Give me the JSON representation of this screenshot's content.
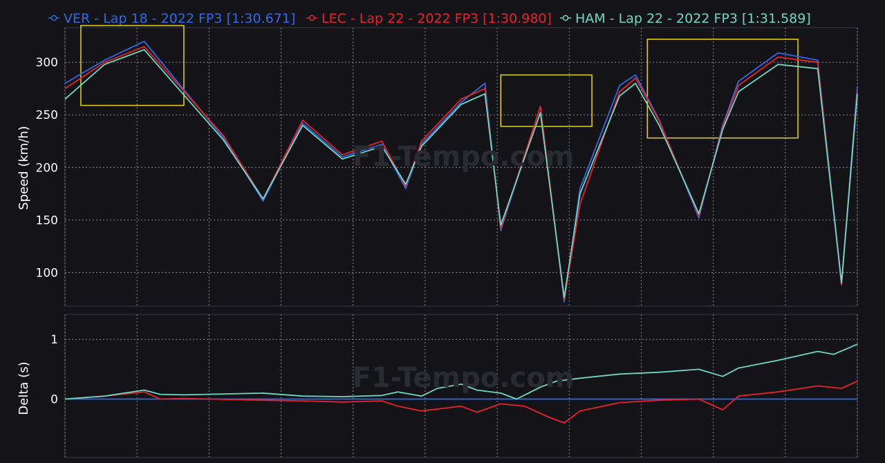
{
  "chart_data": [
    {
      "type": "line",
      "ylabel": "Speed (km/h)",
      "ylim": [
        68,
        333
      ],
      "yticks": [
        100,
        150,
        200,
        250,
        300
      ],
      "grid": true,
      "legend_position": "top",
      "watermark": "F1-Tempo.com",
      "series": [
        {
          "name": "VER - Lap 18 - 2022 FP3 [1:30.671]",
          "color": "#2f6be6",
          "x": [
            0,
            5,
            10,
            20,
            25,
            30,
            35,
            40,
            43,
            45,
            50,
            53,
            55,
            60,
            63,
            65,
            70,
            72,
            75,
            80,
            83,
            85,
            90,
            95,
            98,
            100
          ],
          "values": [
            280,
            302,
            320,
            228,
            168,
            242,
            210,
            222,
            180,
            222,
            262,
            280,
            140,
            258,
            72,
            180,
            278,
            288,
            245,
            152,
            240,
            282,
            309,
            302,
            90,
            277
          ]
        },
        {
          "name": "LEC - Lap 22 - 2022 FP3 [1:30.980]",
          "color": "#e8232b",
          "x": [
            0,
            5,
            10,
            20,
            25,
            30,
            35,
            40,
            43,
            45,
            50,
            53,
            55,
            60,
            63,
            65,
            70,
            72,
            75,
            80,
            83,
            85,
            90,
            95,
            98,
            100
          ],
          "values": [
            275,
            300,
            315,
            230,
            170,
            245,
            212,
            225,
            182,
            225,
            265,
            275,
            142,
            258,
            74,
            165,
            272,
            285,
            244,
            154,
            238,
            278,
            305,
            300,
            88,
            272
          ]
        },
        {
          "name": "HAM - Lap 22 - 2022 FP3 [1:31.589]",
          "color": "#6fd8c4",
          "x": [
            0,
            5,
            10,
            20,
            25,
            30,
            35,
            40,
            43,
            45,
            50,
            53,
            55,
            60,
            63,
            65,
            70,
            72,
            75,
            80,
            83,
            85,
            90,
            95,
            98,
            100
          ],
          "values": [
            265,
            298,
            312,
            226,
            170,
            240,
            208,
            220,
            184,
            220,
            260,
            270,
            145,
            252,
            76,
            175,
            268,
            280,
            240,
            156,
            236,
            272,
            298,
            294,
            90,
            270
          ]
        }
      ],
      "highlights": [
        {
          "x": [
            2,
            15
          ],
          "y": [
            259,
            335
          ]
        },
        {
          "x": [
            55,
            66.5
          ],
          "y": [
            239,
            288
          ]
        },
        {
          "x": [
            73.5,
            92.5
          ],
          "y": [
            228,
            322
          ]
        }
      ]
    },
    {
      "type": "line",
      "ylabel": "Delta (s)",
      "ylim": [
        -0.98,
        1.42
      ],
      "yticks": [
        0,
        1
      ],
      "grid": true,
      "series": [
        {
          "name": "VER - Lap 18 - 2022 FP3 [1:30.671]",
          "color": "#2f6be6",
          "x": [
            0,
            100
          ],
          "values": [
            0,
            0
          ]
        },
        {
          "name": "LEC - Lap 22 - 2022 FP3 [1:30.980]",
          "color": "#e8232b",
          "x": [
            0,
            5,
            10,
            12,
            15,
            25,
            30,
            35,
            40,
            42,
            45,
            50,
            52,
            55,
            58,
            61,
            63,
            65,
            70,
            75,
            80,
            83,
            85,
            90,
            95,
            98,
            100
          ],
          "values": [
            0,
            0.05,
            0.12,
            0.0,
            0.01,
            -0.02,
            -0.03,
            -0.05,
            -0.03,
            -0.12,
            -0.2,
            -0.12,
            -0.22,
            -0.08,
            -0.12,
            -0.3,
            -0.4,
            -0.2,
            -0.06,
            -0.02,
            0.0,
            -0.18,
            0.05,
            0.12,
            0.22,
            0.18,
            0.3
          ]
        },
        {
          "name": "HAM - Lap 22 - 2022 FP3 [1:31.589]",
          "color": "#6fd8c4",
          "x": [
            0,
            5,
            10,
            12,
            15,
            25,
            30,
            35,
            40,
            42,
            45,
            47,
            50,
            52,
            55,
            57,
            60,
            62,
            65,
            70,
            75,
            80,
            83,
            85,
            90,
            95,
            97,
            100
          ],
          "values": [
            0,
            0.05,
            0.15,
            0.08,
            0.07,
            0.1,
            0.05,
            0.04,
            0.06,
            0.12,
            0.05,
            0.18,
            0.25,
            0.15,
            0.1,
            0.0,
            0.2,
            0.3,
            0.35,
            0.42,
            0.45,
            0.5,
            0.38,
            0.52,
            0.65,
            0.8,
            0.75,
            0.92
          ]
        }
      ]
    }
  ]
}
